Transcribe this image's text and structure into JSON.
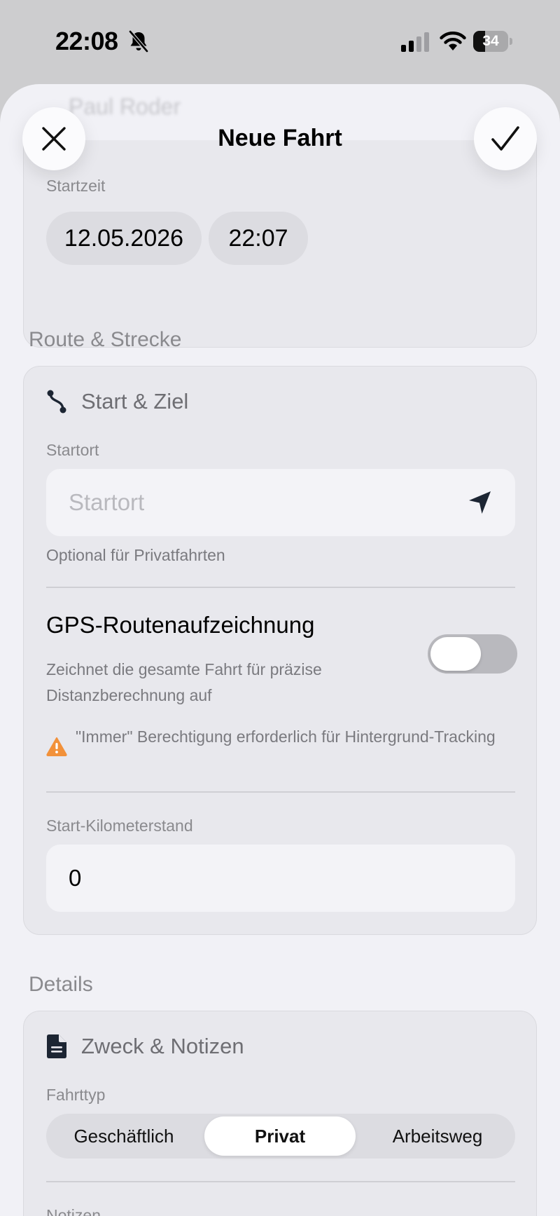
{
  "status_bar": {
    "time": "22:08",
    "battery_level": "34",
    "battery_fraction": 0.34,
    "icons": [
      "bell-slash-icon",
      "cellular-signal-icon",
      "wifi-icon",
      "battery-icon"
    ]
  },
  "header": {
    "title": "Neue Fahrt",
    "background_name": "Paul Roder",
    "close_icon": "xmark-icon",
    "confirm_icon": "checkmark-icon"
  },
  "start_time": {
    "label": "Startzeit",
    "date": "12.05.2026",
    "time": "22:07"
  },
  "route_section": {
    "header": "Route & Strecke",
    "card_title": "Start & Ziel",
    "card_icon": "route-icon",
    "start_location": {
      "label": "Startort",
      "placeholder": "Startort",
      "icon": "location-arrow-icon",
      "hint": "Optional für Privatfahrten"
    },
    "gps": {
      "title": "GPS-Routenaufzeichnung",
      "description": "Zeichnet die gesamte Fahrt für präzise Distanzberechnung auf",
      "enabled": false,
      "warning": "\"Immer\" Berechtigung erforderlich für Hintergrund-Tracking",
      "warning_icon": "warning-triangle-icon"
    },
    "odometer": {
      "label": "Start-Kilometerstand",
      "value": "0"
    }
  },
  "details_section": {
    "header": "Details",
    "card_title": "Zweck & Notizen",
    "card_icon": "document-icon",
    "trip_type": {
      "label": "Fahrttyp",
      "options": [
        "Geschäftlich",
        "Privat",
        "Arbeitsweg"
      ],
      "selected": "Privat"
    },
    "notes_label": "Notizen"
  },
  "colors": {
    "sheet_background": "#f1f1f6",
    "card_background": "#e8e8ed",
    "warning_orange": "#f2913a",
    "icon_dark": "#1c2533"
  }
}
